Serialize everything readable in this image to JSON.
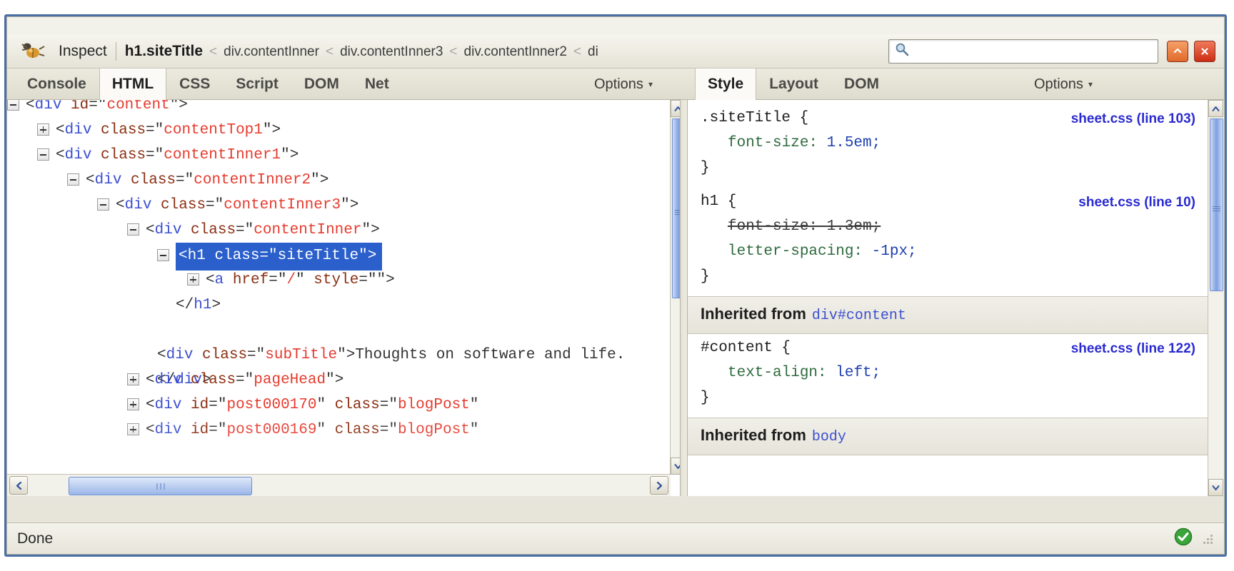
{
  "window": {
    "minimize_title": "Minimize",
    "close_title": "Close"
  },
  "toolbar": {
    "bug_icon": "firebug-bug-icon",
    "inspect_label": "Inspect",
    "breadcrumb": {
      "current": "h1.siteTitle",
      "separator": "<",
      "ancestors": [
        "div.contentInner",
        "div.contentInner3",
        "div.contentInner2",
        "di"
      ]
    },
    "search": {
      "value": "",
      "placeholder": "",
      "icon": "magnifier-icon"
    }
  },
  "left_panel": {
    "tabs": [
      {
        "label": "Console",
        "active": false
      },
      {
        "label": "HTML",
        "active": true
      },
      {
        "label": "CSS",
        "active": false
      },
      {
        "label": "Script",
        "active": false
      },
      {
        "label": "DOM",
        "active": false
      },
      {
        "label": "Net",
        "active": false
      }
    ],
    "options_label": "Options",
    "options_caret": "▾",
    "tree": [
      {
        "indent": 0,
        "twisty": "minus",
        "selected": false,
        "clipped": true,
        "parts": [
          {
            "t": "punct",
            "s": "<"
          },
          {
            "t": "tag",
            "s": "div"
          },
          {
            "t": "punct",
            "s": " "
          },
          {
            "t": "attr",
            "s": "id"
          },
          {
            "t": "punct",
            "s": "=\""
          },
          {
            "t": "val",
            "s": "content"
          },
          {
            "t": "punct",
            "s": "\">"
          }
        ]
      },
      {
        "indent": 1,
        "twisty": "plus",
        "selected": false,
        "parts": [
          {
            "t": "punct",
            "s": "<"
          },
          {
            "t": "tag",
            "s": "div"
          },
          {
            "t": "punct",
            "s": " "
          },
          {
            "t": "attr",
            "s": "class"
          },
          {
            "t": "punct",
            "s": "=\""
          },
          {
            "t": "val",
            "s": "contentTop1"
          },
          {
            "t": "punct",
            "s": "\">"
          }
        ]
      },
      {
        "indent": 1,
        "twisty": "minus",
        "selected": false,
        "parts": [
          {
            "t": "punct",
            "s": "<"
          },
          {
            "t": "tag",
            "s": "div"
          },
          {
            "t": "punct",
            "s": " "
          },
          {
            "t": "attr",
            "s": "class"
          },
          {
            "t": "punct",
            "s": "=\""
          },
          {
            "t": "val",
            "s": "contentInner1"
          },
          {
            "t": "punct",
            "s": "\">"
          }
        ]
      },
      {
        "indent": 2,
        "twisty": "minus",
        "selected": false,
        "parts": [
          {
            "t": "punct",
            "s": "<"
          },
          {
            "t": "tag",
            "s": "div"
          },
          {
            "t": "punct",
            "s": " "
          },
          {
            "t": "attr",
            "s": "class"
          },
          {
            "t": "punct",
            "s": "=\""
          },
          {
            "t": "val",
            "s": "contentInner2"
          },
          {
            "t": "punct",
            "s": "\">"
          }
        ]
      },
      {
        "indent": 3,
        "twisty": "minus",
        "selected": false,
        "parts": [
          {
            "t": "punct",
            "s": "<"
          },
          {
            "t": "tag",
            "s": "div"
          },
          {
            "t": "punct",
            "s": " "
          },
          {
            "t": "attr",
            "s": "class"
          },
          {
            "t": "punct",
            "s": "=\""
          },
          {
            "t": "val",
            "s": "contentInner3"
          },
          {
            "t": "punct",
            "s": "\">"
          }
        ]
      },
      {
        "indent": 4,
        "twisty": "minus",
        "selected": false,
        "parts": [
          {
            "t": "punct",
            "s": "<"
          },
          {
            "t": "tag",
            "s": "div"
          },
          {
            "t": "punct",
            "s": " "
          },
          {
            "t": "attr",
            "s": "class"
          },
          {
            "t": "punct",
            "s": "=\""
          },
          {
            "t": "val",
            "s": "contentInner"
          },
          {
            "t": "punct",
            "s": "\">"
          }
        ]
      },
      {
        "indent": 5,
        "twisty": "minus",
        "selected": true,
        "parts": [
          {
            "t": "punct",
            "s": "<"
          },
          {
            "t": "tag",
            "s": "h1"
          },
          {
            "t": "punct",
            "s": " "
          },
          {
            "t": "attr",
            "s": "class"
          },
          {
            "t": "punct",
            "s": "=\""
          },
          {
            "t": "val",
            "s": "siteTitle"
          },
          {
            "t": "punct",
            "s": "\">"
          }
        ]
      },
      {
        "indent": 6,
        "twisty": "plus",
        "selected": false,
        "parts": [
          {
            "t": "punct",
            "s": "<"
          },
          {
            "t": "tag",
            "s": "a"
          },
          {
            "t": "punct",
            "s": " "
          },
          {
            "t": "attr",
            "s": "href"
          },
          {
            "t": "punct",
            "s": "=\""
          },
          {
            "t": "val",
            "s": "/"
          },
          {
            "t": "punct",
            "s": "\" "
          },
          {
            "t": "attr",
            "s": "style"
          },
          {
            "t": "punct",
            "s": "=\"\">"
          }
        ]
      },
      {
        "indent": 5,
        "twisty": "none",
        "selected": false,
        "parts": [
          {
            "t": "punct",
            "s": "</"
          },
          {
            "t": "tag",
            "s": "h1"
          },
          {
            "t": "punct",
            "s": ">"
          }
        ]
      },
      {
        "indent": 5,
        "twisty": "none",
        "selected": false,
        "wrap": true,
        "parts": [
          {
            "t": "punct",
            "s": "<"
          },
          {
            "t": "tag",
            "s": "div"
          },
          {
            "t": "punct",
            "s": " "
          },
          {
            "t": "attr",
            "s": "class"
          },
          {
            "t": "punct",
            "s": "=\""
          },
          {
            "t": "val",
            "s": "subTitle"
          },
          {
            "t": "punct",
            "s": "\">"
          },
          {
            "t": "txt",
            "s": "Thoughts on software and life."
          },
          {
            "t": "punct",
            "s": "</"
          },
          {
            "t": "tag",
            "s": "div"
          },
          {
            "t": "punct",
            "s": ">"
          }
        ]
      },
      {
        "indent": 4,
        "twisty": "plus",
        "selected": false,
        "parts": [
          {
            "t": "punct",
            "s": "<"
          },
          {
            "t": "tag",
            "s": "div"
          },
          {
            "t": "punct",
            "s": " "
          },
          {
            "t": "attr",
            "s": "class"
          },
          {
            "t": "punct",
            "s": "=\""
          },
          {
            "t": "val",
            "s": "pageHead"
          },
          {
            "t": "punct",
            "s": "\">"
          }
        ]
      },
      {
        "indent": 4,
        "twisty": "plus",
        "selected": false,
        "parts": [
          {
            "t": "punct",
            "s": "<"
          },
          {
            "t": "tag",
            "s": "div"
          },
          {
            "t": "punct",
            "s": " "
          },
          {
            "t": "attr",
            "s": "id"
          },
          {
            "t": "punct",
            "s": "=\""
          },
          {
            "t": "val",
            "s": "post000170"
          },
          {
            "t": "punct",
            "s": "\" "
          },
          {
            "t": "attr",
            "s": "class"
          },
          {
            "t": "punct",
            "s": "=\""
          },
          {
            "t": "val",
            "s": "blogPost"
          },
          {
            "t": "punct",
            "s": "\""
          }
        ]
      },
      {
        "indent": 4,
        "twisty": "plus",
        "selected": false,
        "clipped_bottom": true,
        "parts": [
          {
            "t": "punct",
            "s": "<"
          },
          {
            "t": "tag",
            "s": "div"
          },
          {
            "t": "punct",
            "s": " "
          },
          {
            "t": "attr",
            "s": "id"
          },
          {
            "t": "punct",
            "s": "=\""
          },
          {
            "t": "val",
            "s": "post000169"
          },
          {
            "t": "punct",
            "s": "\" "
          },
          {
            "t": "attr",
            "s": "class"
          },
          {
            "t": "punct",
            "s": "=\""
          },
          {
            "t": "val",
            "s": "blogPost"
          },
          {
            "t": "punct",
            "s": "\""
          }
        ]
      }
    ]
  },
  "right_panel": {
    "tabs": [
      {
        "label": "Style",
        "active": true
      },
      {
        "label": "Layout",
        "active": false
      },
      {
        "label": "DOM",
        "active": false
      }
    ],
    "options_label": "Options",
    "options_caret": "▾",
    "sections": [
      {
        "kind": "rules",
        "rules": [
          {
            "selector": ".siteTitle {",
            "source": "sheet.css (line 103)",
            "close": "}",
            "declarations": [
              {
                "name": "font-size",
                "value": "1.5em;",
                "disabled": false
              }
            ]
          },
          {
            "selector": "h1 {",
            "source": "sheet.css (line 10)",
            "close": "}",
            "declarations": [
              {
                "name": "font-size",
                "value": "1.3em;",
                "disabled": true
              },
              {
                "name": "letter-spacing",
                "value": "-1px;",
                "disabled": false
              }
            ]
          }
        ]
      },
      {
        "kind": "inherited",
        "header_label": "Inherited from",
        "header_from": "div#content",
        "rules": [
          {
            "selector": "#content {",
            "source": "sheet.css (line 122)",
            "close": "}",
            "declarations": [
              {
                "name": "text-align",
                "value": "left;",
                "disabled": false
              }
            ]
          }
        ]
      },
      {
        "kind": "inherited",
        "header_label": "Inherited from",
        "header_from": "body",
        "rules": []
      }
    ]
  },
  "statusbar": {
    "text": "Done",
    "status_icon": "green-check-icon",
    "resize_grip": "resize-grip-icon"
  }
}
